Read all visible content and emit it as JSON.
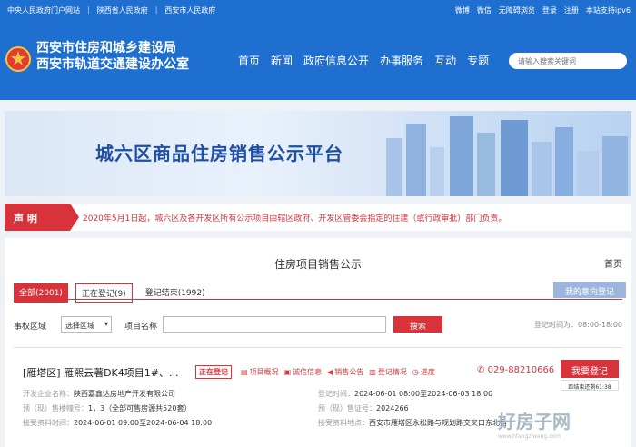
{
  "topbar": {
    "links": [
      "中央人民政府门户网站",
      "陕西省人民政府",
      "西安市人民政府"
    ],
    "right": [
      "微博",
      "微信",
      "无障碍浏览",
      "登录",
      "注册",
      "本站支持ipv6"
    ]
  },
  "header": {
    "org_line1": "西安市住房和城乡建设局",
    "org_line2": "西安市轨道交通建设办公室",
    "nav": [
      "首页",
      "新闻",
      "政府信息公开",
      "办事服务",
      "互动",
      "专题"
    ],
    "search_placeholder": "请输入搜索关键词"
  },
  "banner": {
    "title": "城六区商品住房销售公示平台"
  },
  "notice": {
    "tag": "声 明",
    "text": "2020年5月1日起，城六区及各开发区所有公示项目由辖区政府、开发区管委会指定的住建（或行政审批）部门负责。"
  },
  "panel": {
    "title": "住房项目销售公示",
    "home": "首页",
    "tabs": [
      "全部(2001)",
      "正在登记(9)",
      "登记结束(1992)"
    ],
    "my_reg": "我的意向登记",
    "filter": {
      "district_label": "事权区域",
      "district_value": "选择区域",
      "name_label": "项目名称",
      "search_btn": "搜索",
      "reg_time": "登记时间为：08:00-18:00"
    },
    "project": {
      "name": "[雁塔区] 雁熙云著DK4项目1#、...",
      "status": "正在登记",
      "links": [
        "项目概况",
        "诚信信息",
        "销售公告",
        "登记情况",
        "进度"
      ],
      "phone": "029-88210666",
      "reg_btn": "我要登记",
      "countdown": "距结束还剩61:38",
      "dev_label": "开发企业名称：",
      "dev": "陕西嘉鑫达房地产开发有限公司",
      "reg_time_label": "登记时间：",
      "reg_time": "2024-06-01 08:00至2024-06-03 18:00",
      "presale_label": "预（现）售楼幢号：",
      "presale": "1，3（全部可售房源共520套）",
      "cert_label": "预（现）售证号：",
      "cert": "2024266",
      "accept_label": "接受资料时间：",
      "accept": "2024-06-01 09:00至2024-06-04 18:00",
      "place_label": "接受资料地点：",
      "place": "西安市雁塔区永松路与规划路交叉口东北角"
    }
  },
  "watermark": {
    "cn": "好房子网",
    "en": "www.hfangziwang.com"
  },
  "colors": {
    "brand_blue": "#1f6fd0",
    "accent_red": "#d8333b"
  }
}
